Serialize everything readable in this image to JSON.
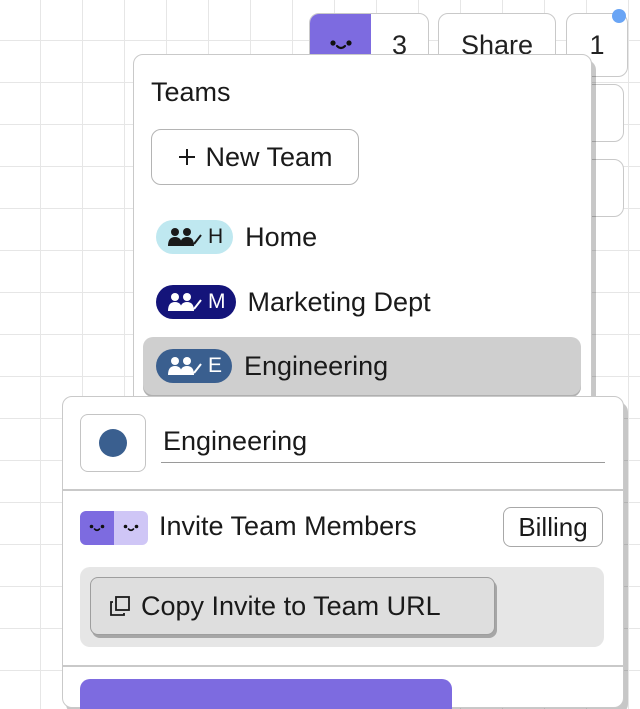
{
  "toolbar": {
    "collaborator_count": "3",
    "share_label": "Share",
    "notification_count": "1",
    "accent_color": "#7d6be0",
    "notification_dot_color": "#6aa5f5"
  },
  "teams_panel": {
    "title": "Teams",
    "new_team_label": "New Team",
    "new_team_icon": "plus-icon",
    "teams": [
      {
        "initial": "H",
        "name": "Home",
        "badge_bg": "#bfe8f0",
        "badge_fg": "#1a1a1a",
        "selected": false
      },
      {
        "initial": "M",
        "name": "Marketing Dept",
        "badge_bg": "#14147a",
        "badge_fg": "#ffffff",
        "selected": false
      },
      {
        "initial": "E",
        "name": "Engineering",
        "badge_bg": "#3a5f8f",
        "badge_fg": "#ffffff",
        "selected": true
      }
    ]
  },
  "team_detail": {
    "name_value": "Engineering",
    "team_color": "#3a5f8f",
    "invite_label": "Invite Team Members",
    "billing_label": "Billing",
    "copy_invite_label": "Copy Invite to Team URL",
    "copy_icon": "copy-icon"
  }
}
